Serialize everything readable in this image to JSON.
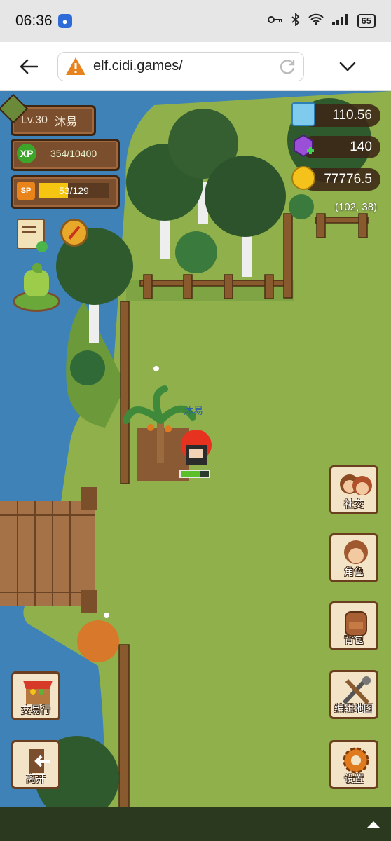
{
  "status_bar": {
    "time": "06:36",
    "battery": "65",
    "icons": [
      "notification-icon",
      "key-icon",
      "bluetooth-icon",
      "wifi-icon",
      "signal-icon",
      "battery-icon"
    ]
  },
  "browser": {
    "url": "elf.cidi.games/",
    "warning_icon": "warning-icon",
    "reload_icon": "reload-icon"
  },
  "player": {
    "level": "Lv.30",
    "name": "沐易",
    "xp_label": "XP",
    "xp_text": "354/10400",
    "xp_fraction": 0.034,
    "sp_label": "SP",
    "sp_text": "53/129",
    "sp_fraction": 0.41,
    "character_name": "沐易"
  },
  "resources": {
    "crystal": "110.56",
    "gem": "140",
    "coin": "77776.5",
    "coords": "(102, 38)"
  },
  "buttons": {
    "social": "社交",
    "character": "角色",
    "backpack": "背包",
    "edit_map": "编辑地图",
    "settings": "设置",
    "market": "交易行",
    "leave": "离开"
  },
  "colors": {
    "grass": "#8fb04a",
    "water": "#3e82b8",
    "panel": "#7b4e2e",
    "xp_green": "#5bbf2a",
    "sp_yellow": "#f6c511"
  }
}
